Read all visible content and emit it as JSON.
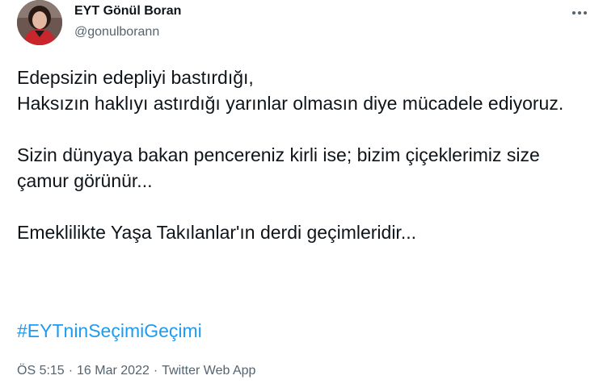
{
  "author": {
    "display_name": "EYT Gönül Boran",
    "handle": "@gonulborann"
  },
  "tweet": {
    "paragraphs": [
      "Edepsizin edepliyi bastırdığı,\nHaksızın haklıyı astırdığı yarınlar olmasın diye mücadele ediyoruz.",
      "Sizin dünyaya bakan pencereniz kirli ise; bizim çiçeklerimiz size çamur görünür...",
      "Emeklilikte Yaşa Takılanlar'ın derdi geçimleridir..."
    ],
    "hashtag": "#EYTninSeçimiGeçimi"
  },
  "meta": {
    "time": "ÖS 5:15",
    "date": "16 Mar 2022",
    "separator": "·",
    "source": "Twitter Web App"
  },
  "colors": {
    "text": "#0f1419",
    "secondary": "#536471",
    "link": "#1d9bf0"
  },
  "icons": {
    "more": "more-horizontal-icon"
  }
}
